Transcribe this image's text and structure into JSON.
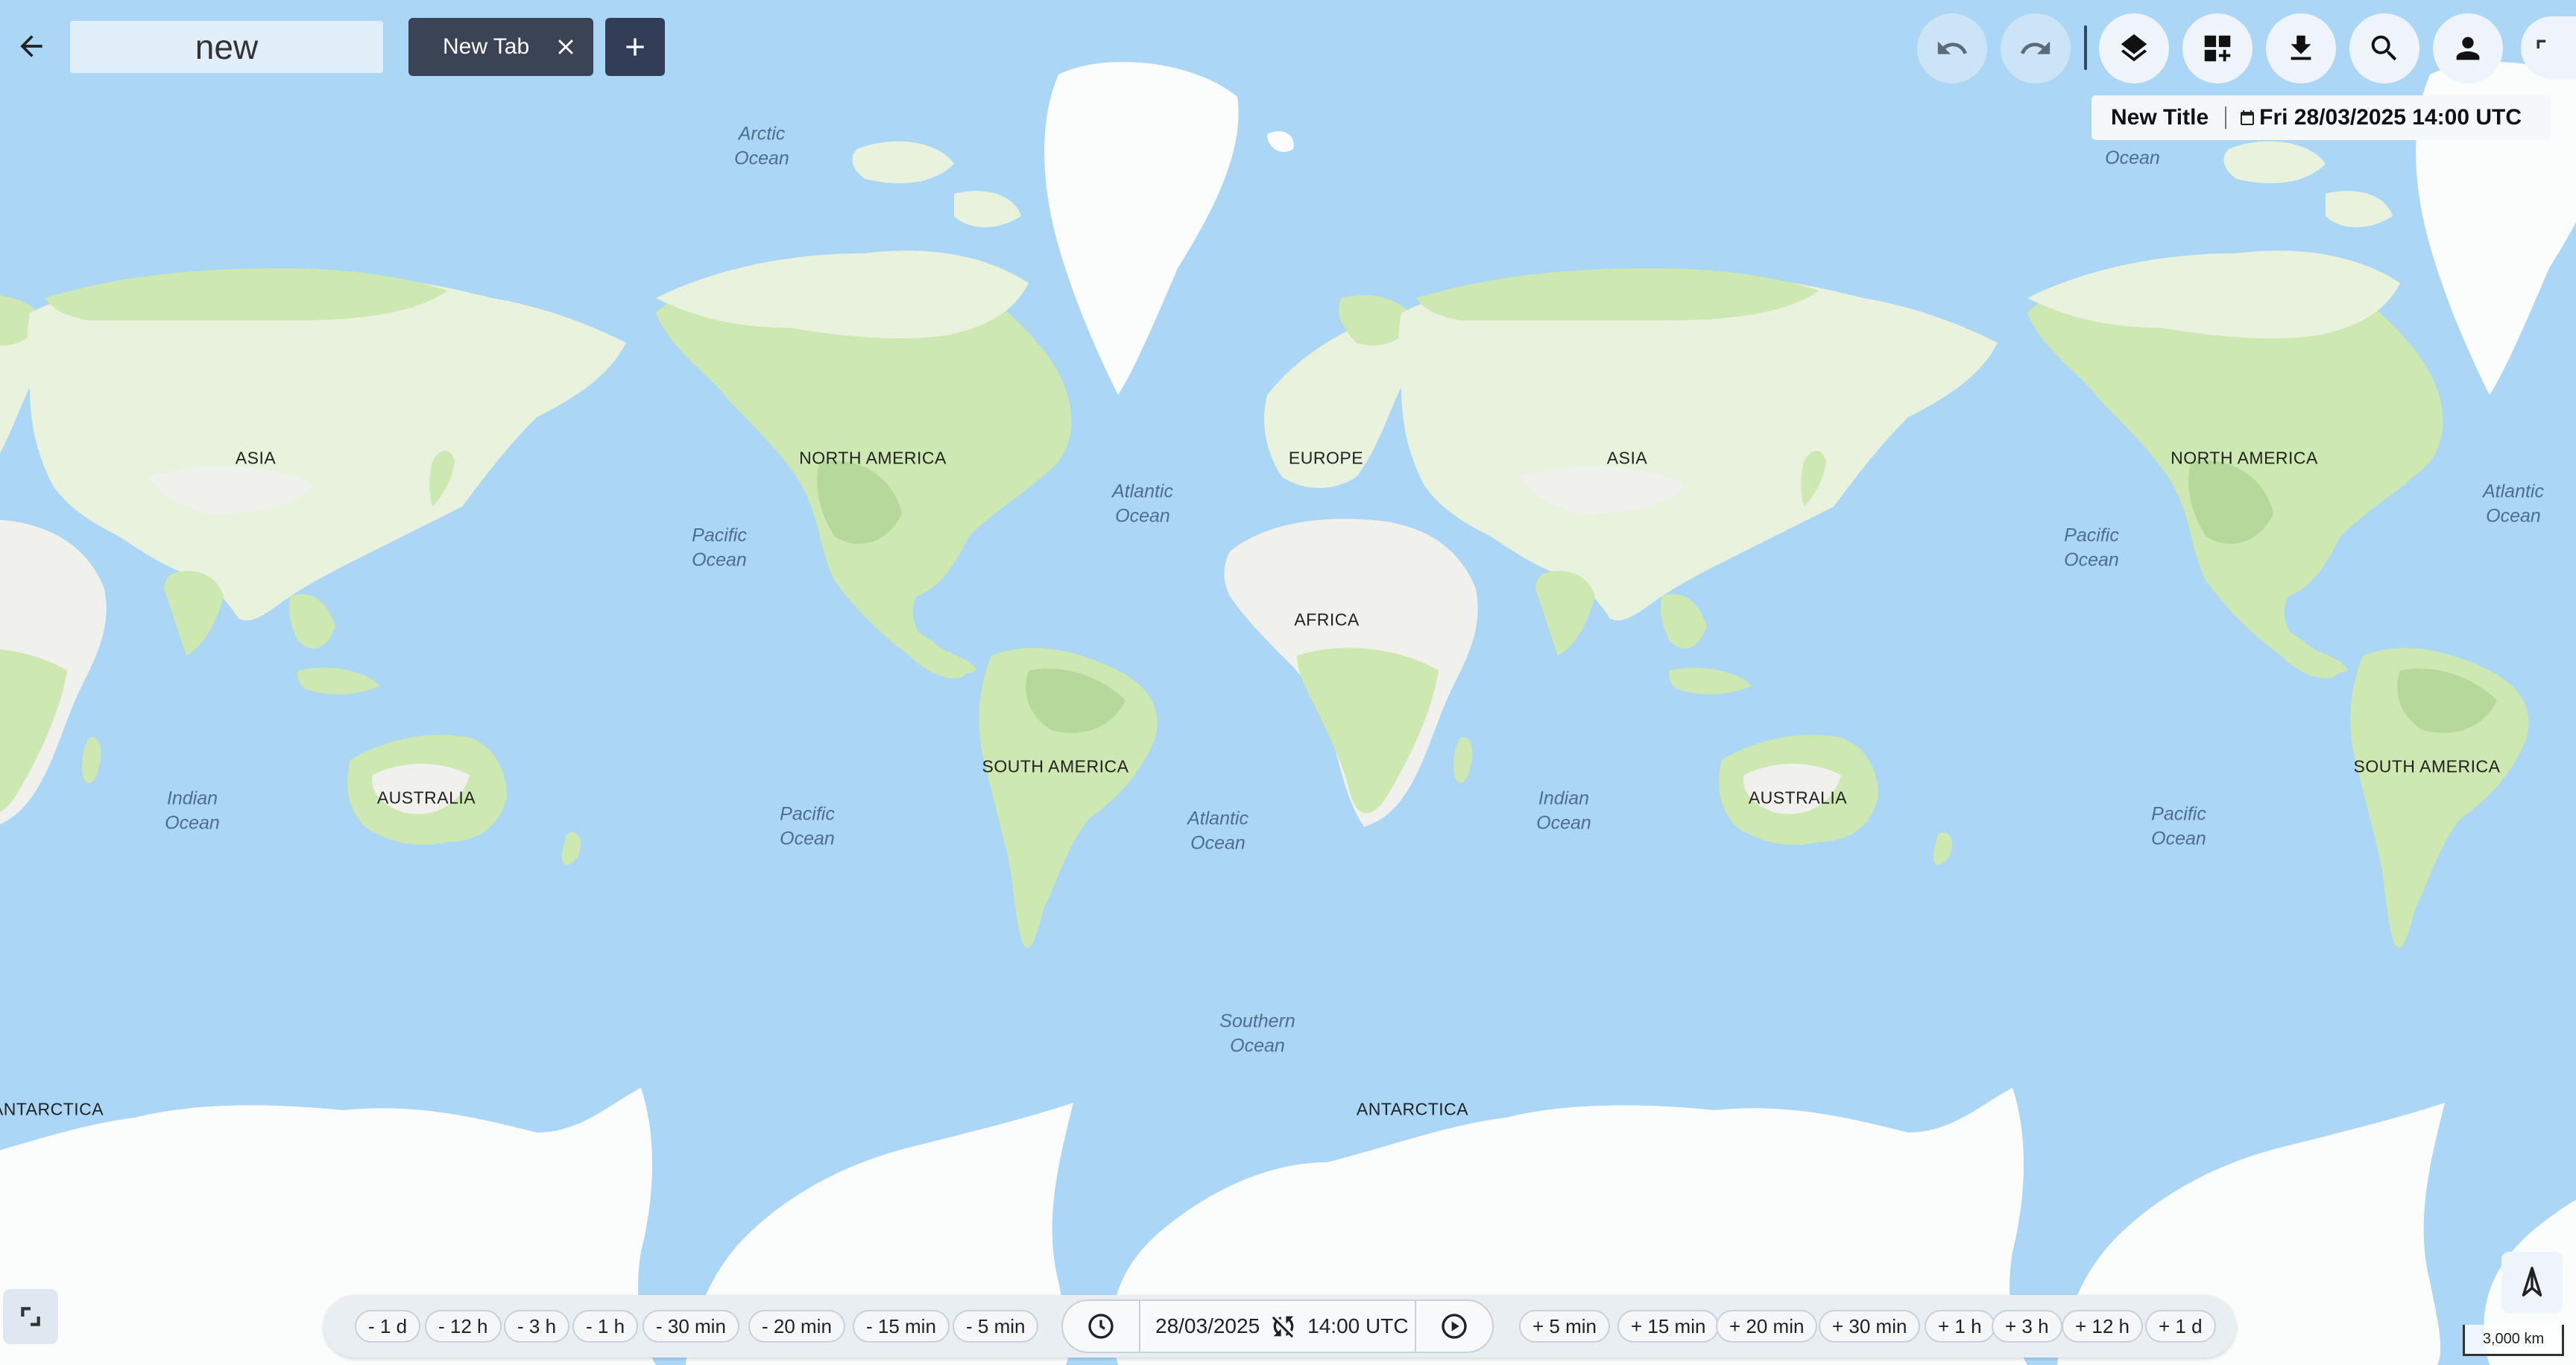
{
  "app": {
    "search_value": "new",
    "tab_label": "New Tab",
    "map_title": "New Title",
    "map_datetime": "Fri 28/03/2025 14:00 UTC"
  },
  "map": {
    "continents": {
      "asia": "ASIA",
      "north_america": "NORTH AMERICA",
      "europe": "EUROPE",
      "africa": "AFRICA",
      "south_america": "SOUTH AMERICA",
      "australia": "AUSTRALIA",
      "antarctica": "ANTARCTICA"
    },
    "oceans": {
      "arctic": "Arctic\nOcean",
      "pacific": "Pacific\nOcean",
      "atlantic": "Atlantic\nOcean",
      "indian": "Indian\nOcean",
      "southern": "Southern\nOcean",
      "ocean_partial": "Ocean"
    },
    "scale": "3,000 km",
    "colors": {
      "water": "#abd6f6",
      "land": "#f0f0ec",
      "vegetation": "#cde8b0",
      "ice": "#fbfcfc"
    }
  },
  "timebar": {
    "back_steps": [
      "- 1 d",
      "- 12 h",
      "- 3 h",
      "- 1 h",
      "- 30 min",
      "- 20 min",
      "- 15 min",
      "- 5 min"
    ],
    "forward_steps": [
      "+ 5 min",
      "+ 15 min",
      "+ 20 min",
      "+ 30 min",
      "+ 1 h",
      "+ 3 h",
      "+ 12 h",
      "+ 1 d"
    ],
    "date": "28/03/2025",
    "time": "14:00 UTC"
  },
  "icons": [
    "back-arrow-icon",
    "close-icon",
    "plus-icon",
    "undo-icon",
    "redo-icon",
    "layers-icon",
    "add-widget-icon",
    "download-icon",
    "search-icon",
    "user-icon",
    "expand-icon",
    "clock-icon",
    "sync-off-icon",
    "play-icon",
    "collapse-icon",
    "compass-icon",
    "calendar-icon"
  ]
}
